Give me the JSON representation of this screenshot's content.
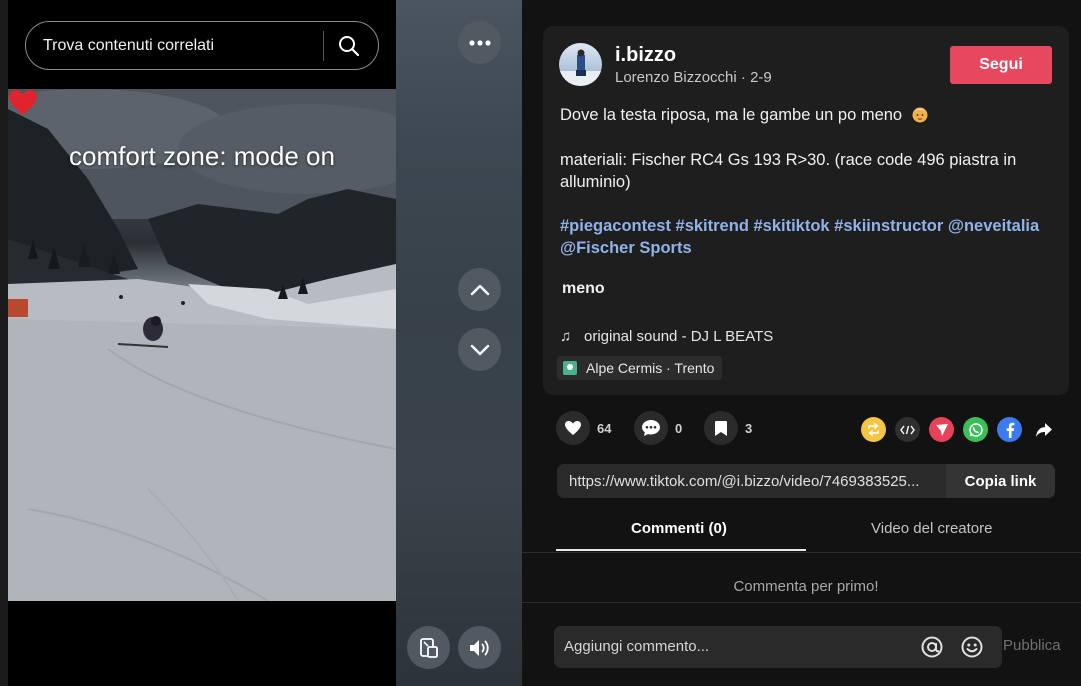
{
  "search": {
    "placeholder": "Trova contenuti correlati"
  },
  "video": {
    "caption": "comfort zone: mode on"
  },
  "post": {
    "username": "i.bizzo",
    "display_name": "Lorenzo Bizzocchi",
    "date": "2-9",
    "follow_label": "Segui",
    "description_line1": "Dove la testa riposa, ma le gambe un po meno",
    "description_line2": "materiali: Fischer RC4 Gs 193 R>30. (race code 496 piastra in alluminio)",
    "hashtags": "#piegacontest #skitrend #skitiktok #skiinstructor @neveitalia @Fischer Sports",
    "less_label": "meno",
    "music": "original sound - DJ L BEATS",
    "location": "Alpe Cermis · Trento"
  },
  "stats": {
    "likes": "64",
    "comments": "0",
    "saves": "3"
  },
  "link": {
    "url": "https://www.tiktok.com/@i.bizzo/video/7469383525...",
    "copy_label": "Copia link"
  },
  "tabs": {
    "comments": "Commenti (0)",
    "creator_videos": "Video del creatore"
  },
  "comments": {
    "empty_message": "Commenta per primo!",
    "input_placeholder": "Aggiungi commento...",
    "publish_label": "Pubblica"
  },
  "colors": {
    "follow": "#e5485f",
    "hashtag": "#8fb3e8",
    "repost": "#f6c642",
    "tiktok_share": "#e8425a",
    "whatsapp": "#3bbf5a",
    "facebook": "#3a7cf0"
  }
}
